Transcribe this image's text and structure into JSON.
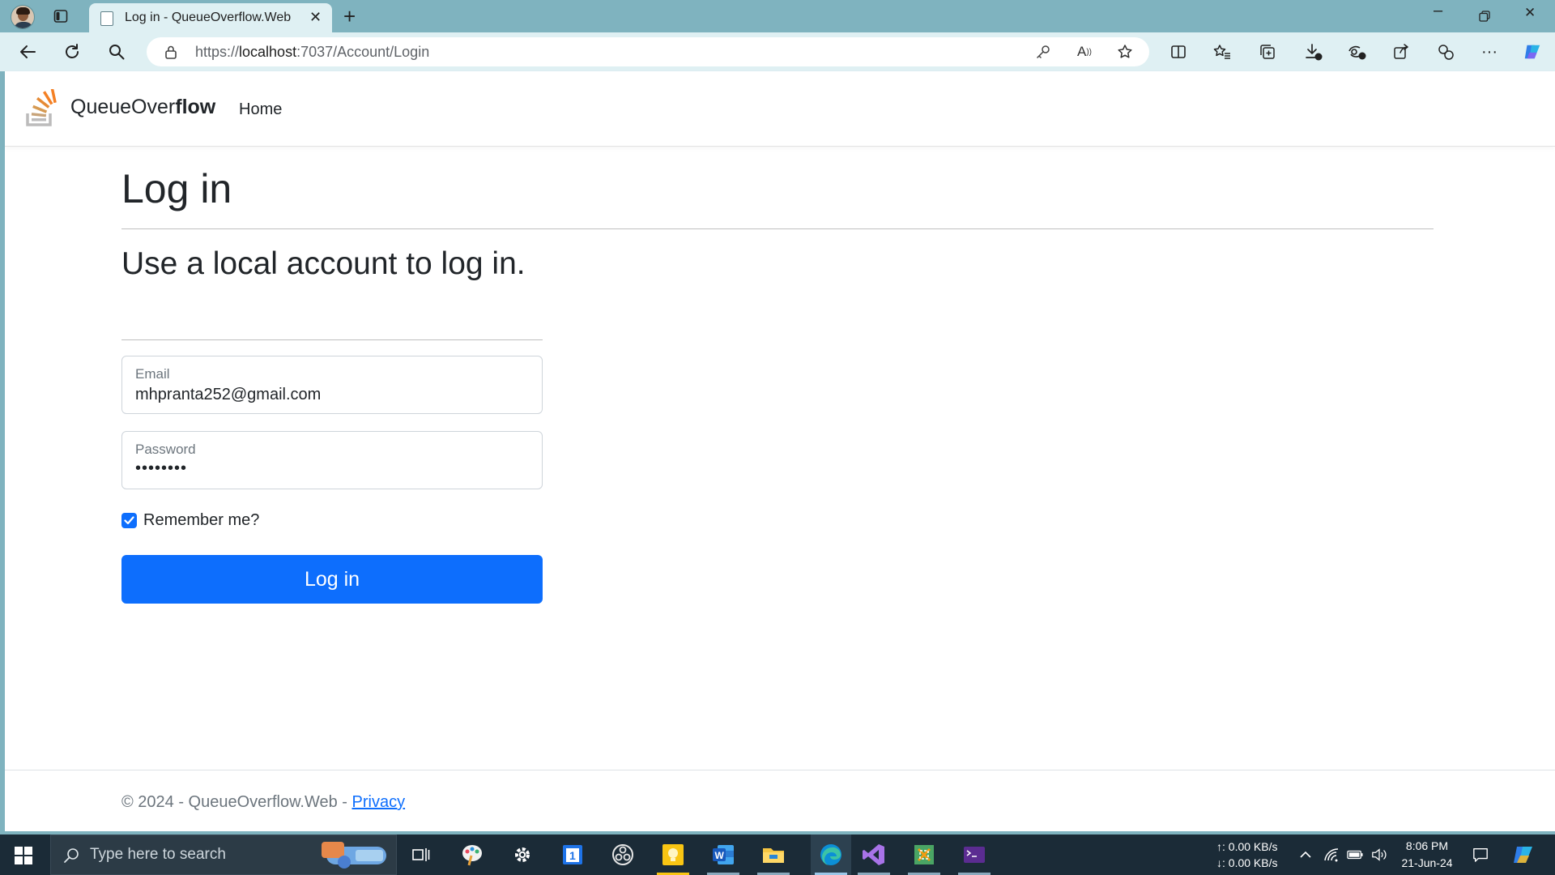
{
  "browser": {
    "tab_title": "Log in - QueueOverflow.Web",
    "url_prefix": "https://",
    "url_host": "localhost",
    "url_rest": ":7037/Account/Login"
  },
  "site": {
    "brand_regular": "QueueOver",
    "brand_bold": "flow",
    "nav_home": "Home"
  },
  "page": {
    "title": "Log in",
    "subtitle": "Use a local account to log in.",
    "email_label": "Email",
    "email_value": "mhpranta252@gmail.com",
    "password_label": "Password",
    "password_value": "••••••••",
    "remember_label": "Remember me?",
    "remember_checked": true,
    "login_button": "Log in"
  },
  "footer": {
    "text": "© 2024 - QueueOverflow.Web - ",
    "privacy_link": "Privacy"
  },
  "taskbar": {
    "search_placeholder": "Type here to search",
    "net_up": "↑: 0.00 KB/s",
    "net_down": "↓: 0.00 KB/s",
    "time": "8:06 PM",
    "date": "21-Jun-24"
  },
  "colors": {
    "accent": "#0d6efd",
    "browser_frame": "#7fb3bf",
    "taskbar": "#1b2b37",
    "brand_orange": "#f48024"
  }
}
